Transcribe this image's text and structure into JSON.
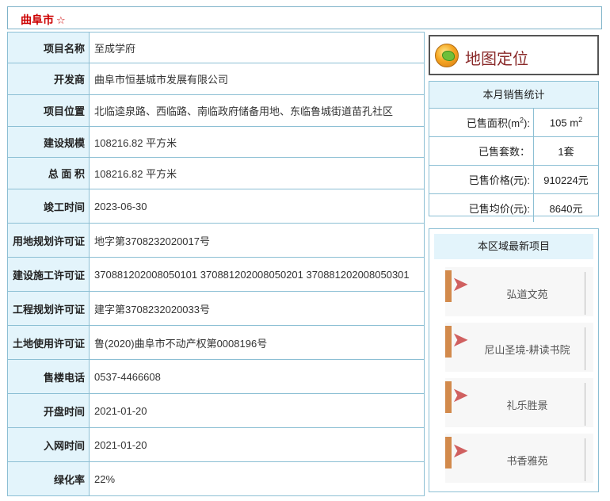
{
  "header": {
    "city": "曲阜市",
    "star": "☆"
  },
  "info": [
    {
      "label": "项目名称",
      "value": "至成学府"
    },
    {
      "label": "开发商",
      "value": "曲阜市恒基城市发展有限公司"
    },
    {
      "label": "项目位置",
      "value": "北临逵泉路、西临路、南临政府储备用地、东临鲁城街道苗孔社区"
    },
    {
      "label": "建设规模",
      "value": "108216.82 平方米"
    },
    {
      "label": "总 面 积",
      "value": "108216.82 平方米"
    },
    {
      "label": "竣工时间",
      "value": "2023-06-30"
    },
    {
      "label": "用地规划许可证",
      "value": "地字第3708232020017号"
    },
    {
      "label": "建设施工许可证",
      "value": "370881202008050101 370881202008050201 370881202008050301"
    },
    {
      "label": "工程规划许可证",
      "value": "建字第3708232020033号"
    },
    {
      "label": "土地使用许可证",
      "value": "鲁(2020)曲阜市不动产权第0008196号"
    },
    {
      "label": "售楼电话",
      "value": "0537-4466608"
    },
    {
      "label": "开盘时间",
      "value": "2021-01-20"
    },
    {
      "label": "入网时间",
      "value": "2021-01-20"
    },
    {
      "label": "绿化率",
      "value": "22%"
    }
  ],
  "map_button": {
    "label": "地图定位",
    "icon": "globe-icon"
  },
  "stats": {
    "title": "本月销售统计",
    "area_label": "已售面积(m",
    "area_label_sup": "2",
    "area_label_end": "):",
    "area_value": "105 m",
    "area_value_sup": "2",
    "count_label": "已售套数：",
    "count_value": "1套",
    "price_label": "已售价格(元):",
    "price_value": "910224元",
    "avg_label": "已售均价(元):",
    "avg_value": "8640元"
  },
  "new_projects": {
    "title": "本区域最新项目",
    "items": [
      {
        "name": "弘道文苑"
      },
      {
        "name": "尼山圣境-耕读书院"
      },
      {
        "name": "礼乐胜景"
      },
      {
        "name": "书香雅苑"
      }
    ]
  },
  "colors": {
    "accent": "#cc0000",
    "label_bg": "#e3f4fb",
    "border": "#8cbfd4"
  }
}
